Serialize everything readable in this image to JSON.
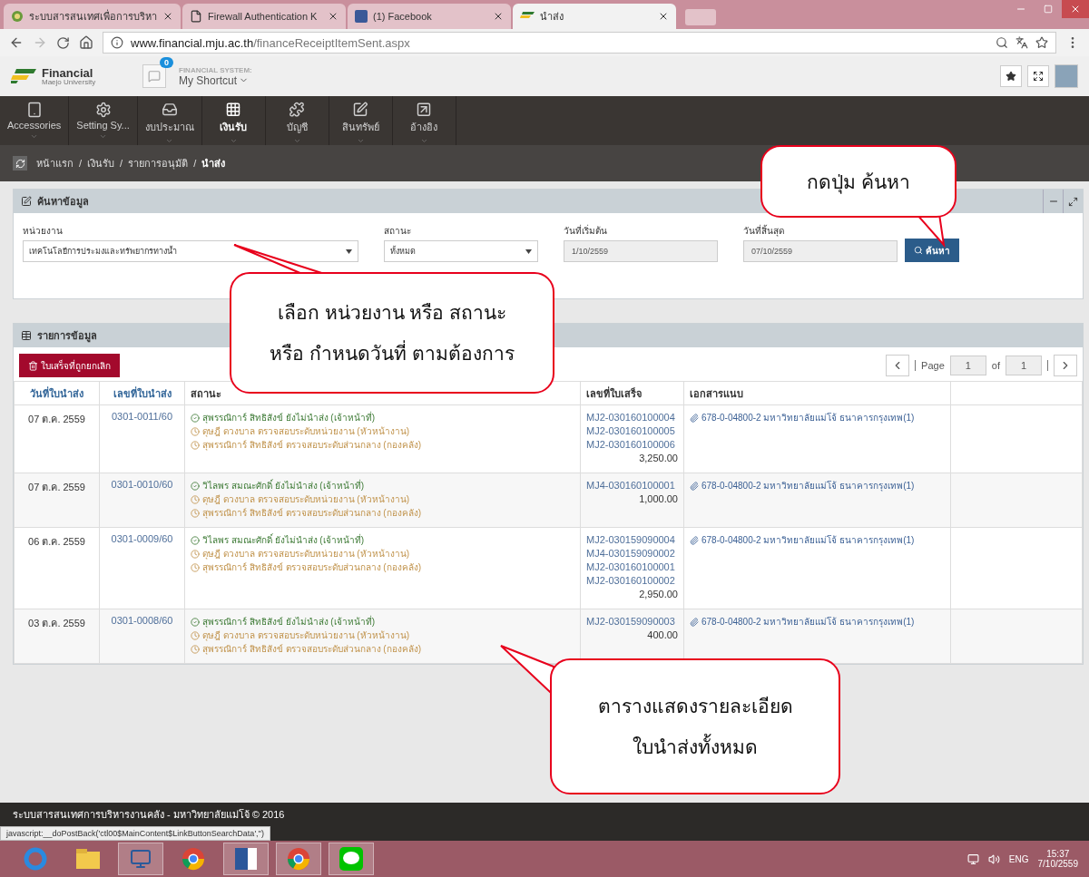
{
  "browser": {
    "tabs": [
      {
        "title": "ระบบสารสนเทศเพื่อการบริหา",
        "selected": false
      },
      {
        "title": "Firewall Authentication K",
        "selected": false
      },
      {
        "title": "(1) Facebook",
        "selected": false
      },
      {
        "title": "นำส่ง",
        "selected": true
      }
    ],
    "url_host": "www.financial.mju.ac.th",
    "url_path": "/financeReceiptItemSent.aspx",
    "status_url": "javascript:__doPostBack('ctl00$MainContent$LinkButtonSearchData','')"
  },
  "header": {
    "brand": "Financial",
    "brand_sub": "Maejo University",
    "notification_count": "0",
    "system_label": "FINANCIAL SYSTEM:",
    "shortcut": "My Shortcut"
  },
  "nav": [
    {
      "label": "Accessories",
      "selected": false
    },
    {
      "label": "Setting Sy...",
      "selected": false
    },
    {
      "label": "งบประมาณ",
      "selected": false
    },
    {
      "label": "เงินรับ",
      "selected": true
    },
    {
      "label": "บัญชี",
      "selected": false
    },
    {
      "label": "สินทรัพย์",
      "selected": false
    },
    {
      "label": "อ้างอิง",
      "selected": false
    }
  ],
  "breadcrumb": {
    "separator": "/",
    "items": [
      "หน้าแรก",
      "เงินรับ",
      "รายการอนุมัติ",
      "นำส่ง"
    ]
  },
  "search_panel": {
    "title": "ค้นหาข้อมูล",
    "fields": [
      {
        "kind": "select",
        "label": "หน่วยงาน",
        "value": "เทคโนโลยีการประมงและทรัพยากรทางน้ำ"
      },
      {
        "kind": "select",
        "label": "สถานะ",
        "value": "ทั้งหมด"
      },
      {
        "kind": "date",
        "label": "วันที่เริ่มต้น",
        "value": "1/10/2559"
      },
      {
        "kind": "date",
        "label": "วันที่สิ้นสุด",
        "value": "07/10/2559"
      }
    ],
    "search_button": "ค้นหา"
  },
  "list_panel": {
    "title": "รายการข้อมูล",
    "cancelled_button": "ใบเสร็จที่ถูกยกเลิก",
    "pager": {
      "page_label": "Page",
      "page": "1",
      "of_label": "of",
      "total": "1"
    },
    "columns": [
      "วันที่ใบนำส่ง",
      "เลขที่ใบนำส่ง",
      "สถานะ",
      "เลขที่ใบเสร็จ",
      "เอกสารแนบ"
    ],
    "rows": [
      {
        "date": "07 ต.ค. 2559",
        "number": "0301-0011/60",
        "statuses": [
          {
            "kind": "done",
            "text": "สุพรรณิการ์ สิทธิสังข์ ยังไม่นำส่ง (เจ้าหน้าที่)"
          },
          {
            "kind": "pending",
            "text": "ดุษฎี ดวงบาล ตรวจสอบระดับหน่วยงาน (หัวหน้างาน)"
          },
          {
            "kind": "pending",
            "text": "สุพรรณิการ์ สิทธิสังข์ ตรวจสอบระดับส่วนกลาง (กองคลัง)"
          }
        ],
        "receipts": [
          "MJ2-030160100004",
          "MJ2-030160100005",
          "MJ2-030160100006"
        ],
        "amount": "3,250.00",
        "attachment": "678-0-04800-2 มหาวิทยาลัยแม่โจ้ ธนาคารกรุงเทพ(1)"
      },
      {
        "date": "07 ต.ค. 2559",
        "number": "0301-0010/60",
        "statuses": [
          {
            "kind": "done",
            "text": "วิไลพร สมณะศักดิ์ ยังไม่นำส่ง (เจ้าหน้าที่)"
          },
          {
            "kind": "pending",
            "text": "ดุษฎี ดวงบาล ตรวจสอบระดับหน่วยงาน (หัวหน้างาน)"
          },
          {
            "kind": "pending",
            "text": "สุพรรณิการ์ สิทธิสังข์ ตรวจสอบระดับส่วนกลาง (กองคลัง)"
          }
        ],
        "receipts": [
          "MJ4-030160100001"
        ],
        "amount": "1,000.00",
        "attachment": "678-0-04800-2 มหาวิทยาลัยแม่โจ้ ธนาคารกรุงเทพ(1)"
      },
      {
        "date": "06 ต.ค. 2559",
        "number": "0301-0009/60",
        "statuses": [
          {
            "kind": "done",
            "text": "วิไลพร สมณะศักดิ์ ยังไม่นำส่ง (เจ้าหน้าที่)"
          },
          {
            "kind": "pending",
            "text": "ดุษฎี ดวงบาล ตรวจสอบระดับหน่วยงาน (หัวหน้างาน)"
          },
          {
            "kind": "pending",
            "text": "สุพรรณิการ์ สิทธิสังข์ ตรวจสอบระดับส่วนกลาง (กองคลัง)"
          }
        ],
        "receipts": [
          "MJ2-030159090004",
          "MJ4-030159090002",
          "MJ2-030160100001",
          "MJ2-030160100002"
        ],
        "amount": "2,950.00",
        "attachment": "678-0-04800-2 มหาวิทยาลัยแม่โจ้ ธนาคารกรุงเทพ(1)"
      },
      {
        "date": "03 ต.ค. 2559",
        "number": "0301-0008/60",
        "statuses": [
          {
            "kind": "done",
            "text": "สุพรรณิการ์ สิทธิสังข์ ยังไม่นำส่ง (เจ้าหน้าที่)"
          },
          {
            "kind": "pending",
            "text": "ดุษฎี ดวงบาล ตรวจสอบระดับหน่วยงาน (หัวหน้างาน)"
          },
          {
            "kind": "pending",
            "text": "สุพรรณิการ์ สิทธิสังข์ ตรวจสอบระดับส่วนกลาง (กองคลัง)"
          }
        ],
        "receipts": [
          "MJ2-030159090003"
        ],
        "amount": "400.00",
        "attachment": "678-0-04800-2 มหาวิทยาลัยแม่โจ้ ธนาคารกรุงเทพ(1)"
      }
    ]
  },
  "footer": "ระบบสารสนเทศการบริหารงานคลัง - มหาวิทยาลัยแม่โจ้ © 2016",
  "callouts": [
    {
      "lines": [
        "กดปุ่ม ค้นหา"
      ]
    },
    {
      "lines": [
        "เลือก หน่วยงาน หรือ สถานะ",
        "หรือ กำหนดวันที่ ตามต้องการ"
      ]
    },
    {
      "lines": [
        "ตารางแสดงรายละเอียด",
        "ใบนำส่งทั้งหมด"
      ]
    }
  ],
  "taskbar": {
    "apps": [
      {
        "selected": false
      },
      {
        "selected": false
      },
      {
        "selected": true
      },
      {
        "selected": false
      },
      {
        "selected": true
      },
      {
        "selected": true
      },
      {
        "selected": true
      }
    ],
    "language": "ENG",
    "time": "15:37",
    "date": "7/10/2559"
  }
}
